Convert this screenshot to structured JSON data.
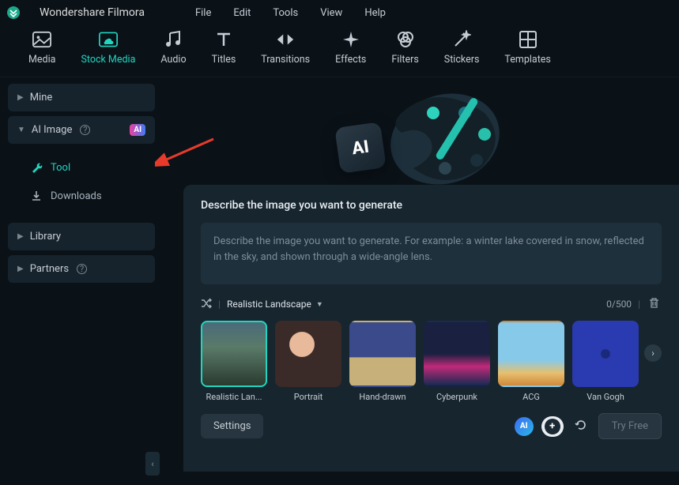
{
  "app": {
    "title": "Wondershare Filmora"
  },
  "menu": [
    "File",
    "Edit",
    "Tools",
    "View",
    "Help"
  ],
  "toolbar": [
    {
      "id": "media",
      "label": "Media"
    },
    {
      "id": "stock",
      "label": "Stock Media",
      "active": true
    },
    {
      "id": "audio",
      "label": "Audio"
    },
    {
      "id": "titles",
      "label": "Titles"
    },
    {
      "id": "transitions",
      "label": "Transitions"
    },
    {
      "id": "effects",
      "label": "Effects"
    },
    {
      "id": "filters",
      "label": "Filters"
    },
    {
      "id": "stickers",
      "label": "Stickers"
    },
    {
      "id": "templates",
      "label": "Templates"
    }
  ],
  "sidebar": {
    "mine": "Mine",
    "ai_image": "AI Image",
    "ai_badge": "AI",
    "tool": "Tool",
    "downloads": "Downloads",
    "library": "Library",
    "partners": "Partners"
  },
  "hero": {
    "ai_tile": "AI"
  },
  "panel": {
    "title": "Describe the image you want to generate",
    "placeholder": "Describe the image you want to generate. For example: a winter lake covered in snow, reflected in the sky, and shown through a wide-angle lens.",
    "style_selected": "Realistic Landscape",
    "counter": "0/500",
    "styles": [
      {
        "id": "realistic",
        "label": "Realistic Lan...",
        "selected": true
      },
      {
        "id": "portrait",
        "label": "Portrait"
      },
      {
        "id": "handdrawn",
        "label": "Hand-drawn"
      },
      {
        "id": "cyberpunk",
        "label": "Cyberpunk"
      },
      {
        "id": "acg",
        "label": "ACG"
      },
      {
        "id": "vangogh",
        "label": "Van Gogh"
      }
    ],
    "settings": "Settings",
    "plus": "+",
    "try_free": "Try Free"
  }
}
